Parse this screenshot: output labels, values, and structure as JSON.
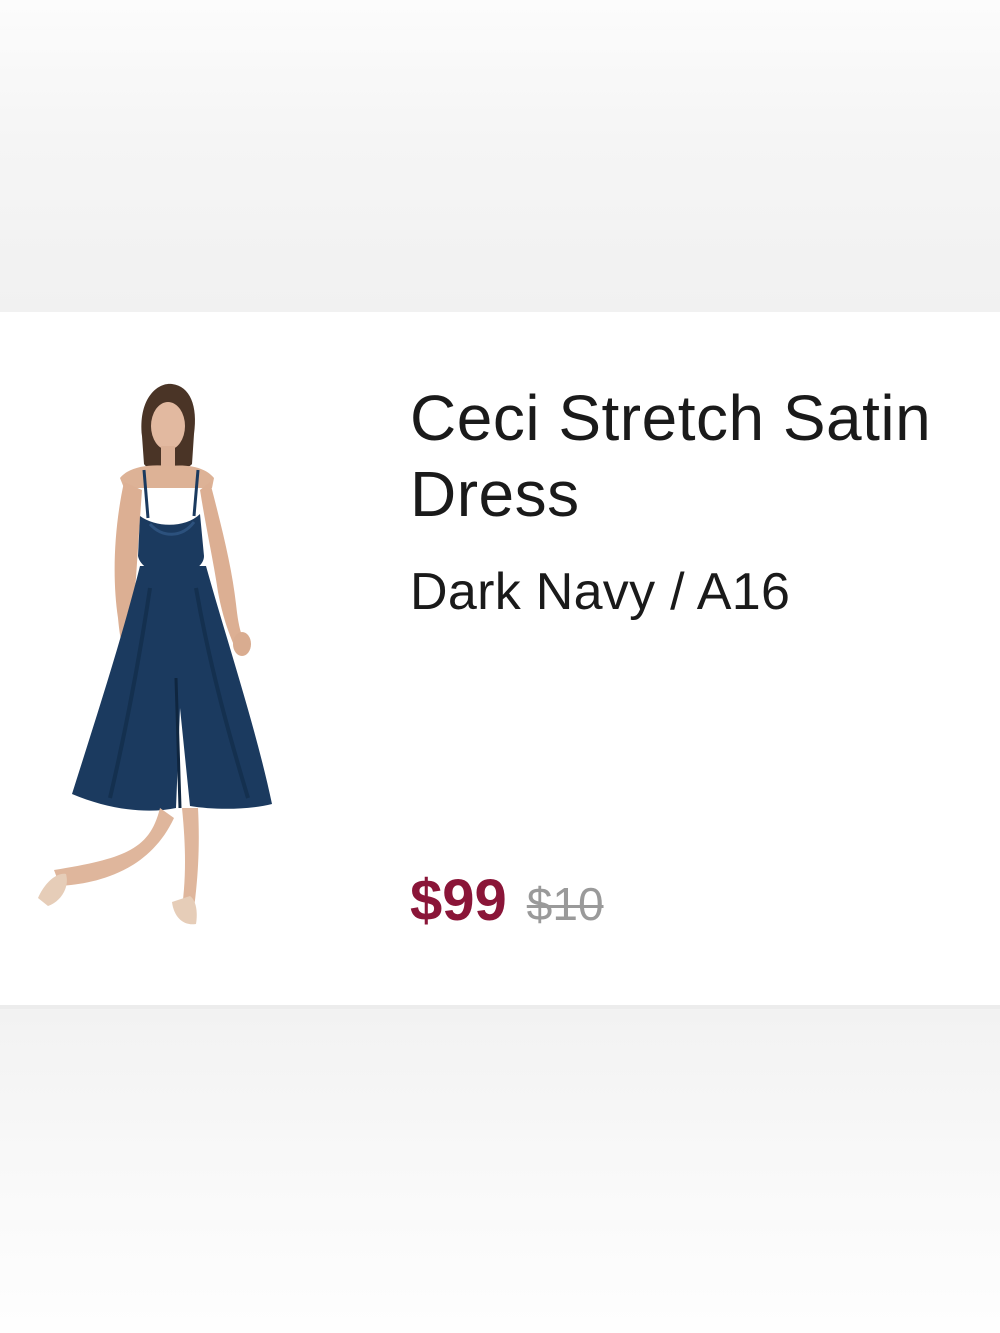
{
  "product": {
    "title": "Ceci Stretch Satin Dress",
    "variant": "Dark Navy / A16",
    "price": {
      "sale": "$99",
      "original": "$10"
    },
    "image_alt": "model wearing dark navy satin midi dress",
    "colors": {
      "sale_price": "#8a1538",
      "original_price": "#9a9a9a",
      "dress": "#1b3a5f"
    }
  }
}
